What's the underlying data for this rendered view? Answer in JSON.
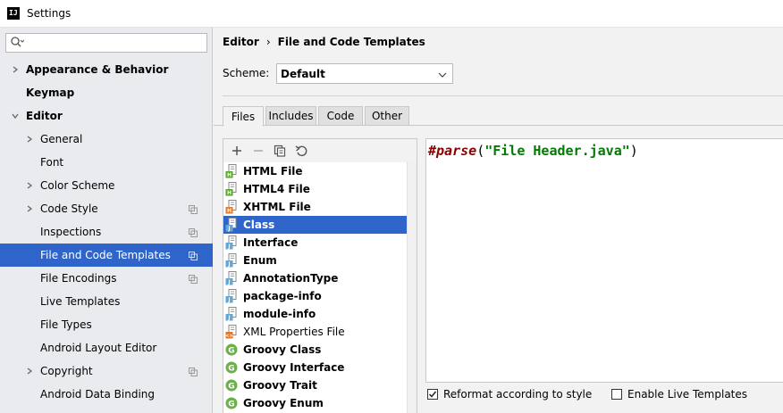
{
  "window": {
    "title": "Settings"
  },
  "search": {
    "placeholder": ""
  },
  "sidebar": {
    "items": [
      {
        "label": "Appearance & Behavior",
        "level": 0,
        "expandable": true,
        "expanded": false,
        "bold": true,
        "has_copy": false
      },
      {
        "label": "Keymap",
        "level": 0,
        "expandable": false,
        "bold": true,
        "has_copy": false
      },
      {
        "label": "Editor",
        "level": 0,
        "expandable": true,
        "expanded": true,
        "bold": true,
        "has_copy": false
      },
      {
        "label": "General",
        "level": 1,
        "expandable": true,
        "expanded": false,
        "has_copy": false
      },
      {
        "label": "Font",
        "level": 1,
        "expandable": false,
        "has_copy": false
      },
      {
        "label": "Color Scheme",
        "level": 1,
        "expandable": true,
        "expanded": false,
        "has_copy": false
      },
      {
        "label": "Code Style",
        "level": 1,
        "expandable": true,
        "expanded": false,
        "has_copy": true
      },
      {
        "label": "Inspections",
        "level": 1,
        "expandable": false,
        "has_copy": true
      },
      {
        "label": "File and Code Templates",
        "level": 1,
        "expandable": false,
        "has_copy": true,
        "selected": true
      },
      {
        "label": "File Encodings",
        "level": 1,
        "expandable": false,
        "has_copy": true
      },
      {
        "label": "Live Templates",
        "level": 1,
        "expandable": false,
        "has_copy": false
      },
      {
        "label": "File Types",
        "level": 1,
        "expandable": false,
        "has_copy": false
      },
      {
        "label": "Android Layout Editor",
        "level": 1,
        "expandable": false,
        "has_copy": false
      },
      {
        "label": "Copyright",
        "level": 1,
        "expandable": true,
        "expanded": false,
        "has_copy": true
      },
      {
        "label": "Android Data Binding",
        "level": 1,
        "expandable": false,
        "has_copy": false
      }
    ]
  },
  "breadcrumb": {
    "parent": "Editor",
    "separator": "›",
    "current": "File and Code Templates"
  },
  "scheme": {
    "label": "Scheme:",
    "value": "Default"
  },
  "tabs": [
    {
      "label": "Files",
      "active": true
    },
    {
      "label": "Includes",
      "active": false
    },
    {
      "label": "Code",
      "active": false
    },
    {
      "label": "Other",
      "active": false
    }
  ],
  "templates": [
    {
      "label": "HTML File",
      "icon": "html-file-icon",
      "badge": "H",
      "badge_color": "#5aa532",
      "bold": true
    },
    {
      "label": "HTML4 File",
      "icon": "html-file-icon",
      "badge": "H",
      "badge_color": "#5aa532",
      "bold": true
    },
    {
      "label": "XHTML File",
      "icon": "xhtml-file-icon",
      "badge": "H",
      "badge_color": "#e07a2f",
      "bold": true
    },
    {
      "label": "Class",
      "icon": "java-file-icon",
      "badge": "J",
      "badge_color": "#5fa8d8",
      "bold": true,
      "selected": true
    },
    {
      "label": "Interface",
      "icon": "java-file-icon",
      "badge": "J",
      "badge_color": "#5fa8d8",
      "bold": true
    },
    {
      "label": "Enum",
      "icon": "java-file-icon",
      "badge": "J",
      "badge_color": "#5fa8d8",
      "bold": true
    },
    {
      "label": "AnnotationType",
      "icon": "java-file-icon",
      "badge": "J",
      "badge_color": "#5fa8d8",
      "bold": true
    },
    {
      "label": "package-info",
      "icon": "java-file-icon",
      "badge": "J",
      "badge_color": "#5fa8d8",
      "bold": true
    },
    {
      "label": "module-info",
      "icon": "java-file-icon",
      "badge": "J",
      "badge_color": "#5fa8d8",
      "bold": true
    },
    {
      "label": "XML Properties File",
      "icon": "xml-file-icon",
      "badge": "<>",
      "badge_color": "#e07a2f",
      "bold": false
    },
    {
      "label": "Groovy Class",
      "icon": "groovy-icon",
      "badge": "G",
      "badge_color": "#6cb04a",
      "bold": true
    },
    {
      "label": "Groovy Interface",
      "icon": "groovy-icon",
      "badge": "G",
      "badge_color": "#6cb04a",
      "bold": true
    },
    {
      "label": "Groovy Trait",
      "icon": "groovy-icon",
      "badge": "G",
      "badge_color": "#6cb04a",
      "bold": true
    },
    {
      "label": "Groovy Enum",
      "icon": "groovy-icon",
      "badge": "G",
      "badge_color": "#6cb04a",
      "bold": true
    }
  ],
  "editor": {
    "directive": "#parse",
    "open": "(",
    "string": "\"File Header.java\"",
    "close": ")"
  },
  "options": {
    "reformat": {
      "label": "Reformat according to style",
      "checked": true
    },
    "live_templates": {
      "label": "Enable Live Templates",
      "checked": false
    }
  },
  "colors": {
    "selection": "#2f65ca",
    "sidebar_bg": "#e9ebee",
    "keyword": "#8b0000",
    "string": "#007a00"
  }
}
